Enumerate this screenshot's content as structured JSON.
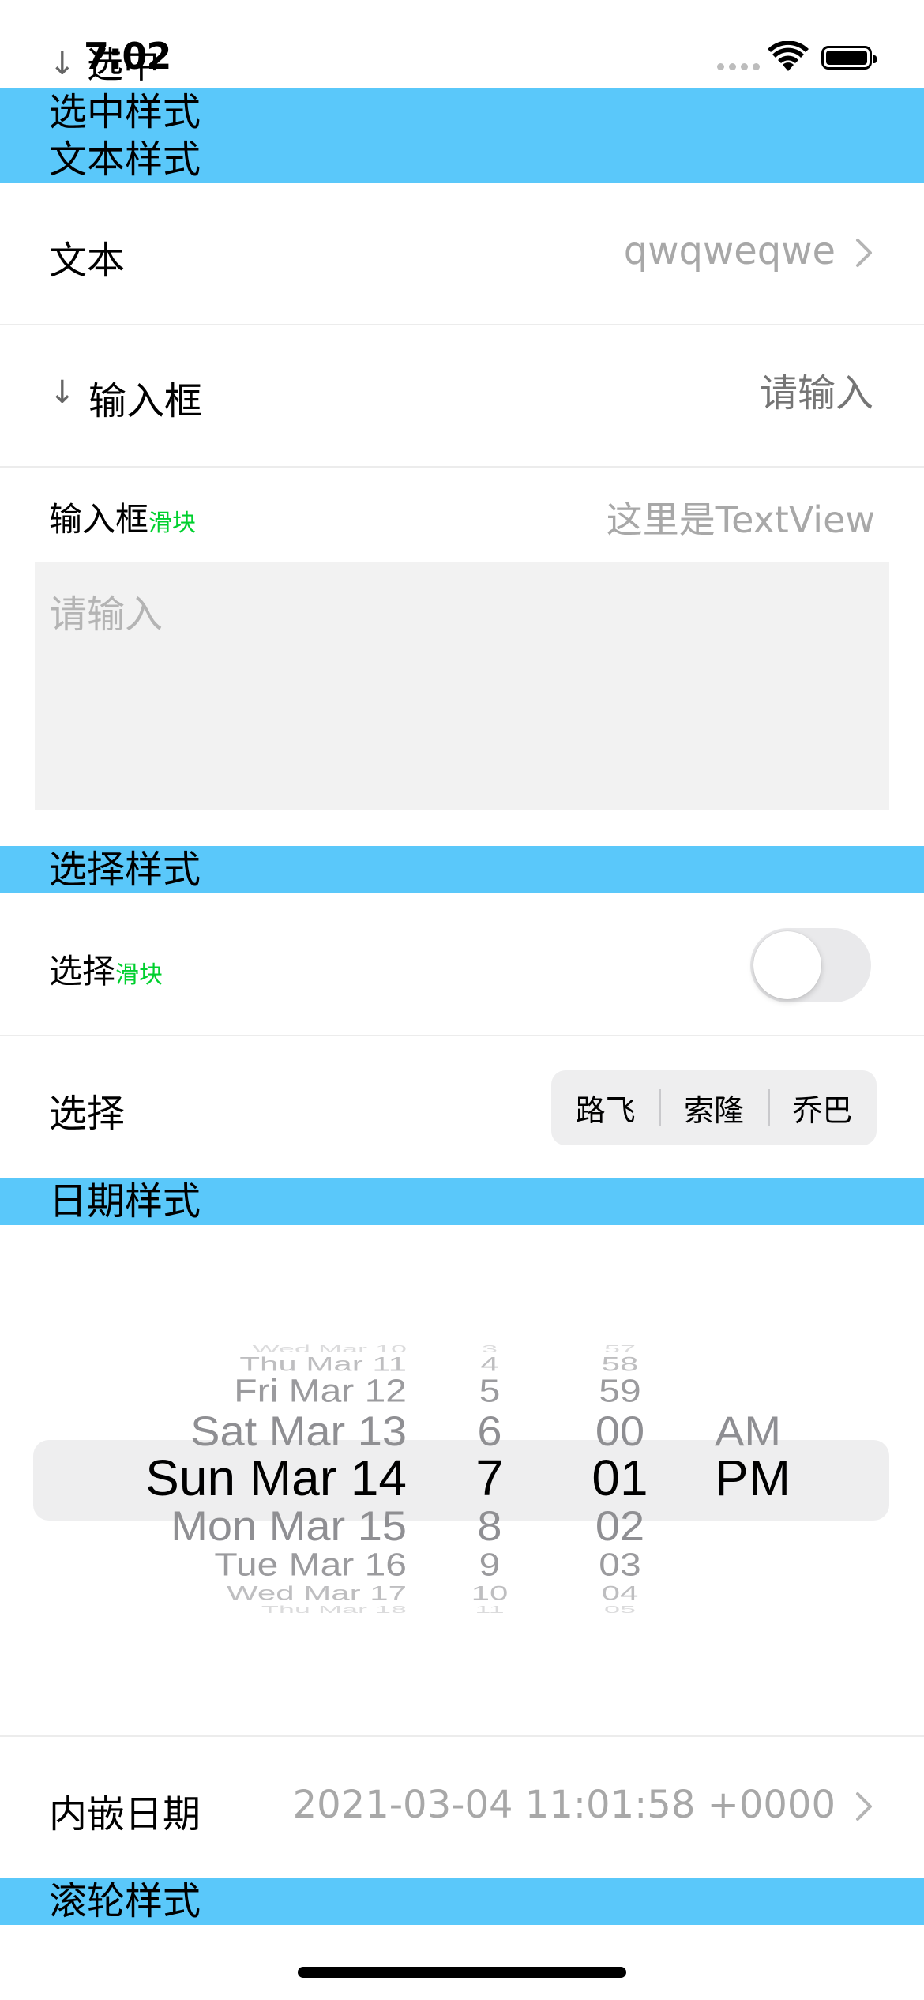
{
  "status_bar": {
    "time": "7:02",
    "overlap_text": "选中",
    "arrow": "↓"
  },
  "sections": {
    "selected_style": "选中样式",
    "text_style": "文本样式",
    "choice_style": "选择样式",
    "date_style": "日期样式",
    "wheel_style": "滚轮样式"
  },
  "text_row": {
    "label": "文本",
    "value": "qwqweqwe"
  },
  "input_row": {
    "arrow": "↓",
    "label": "输入框",
    "placeholder": "请输入"
  },
  "textview_row": {
    "label": "输入框",
    "slider_mark": "滑块",
    "value": "这里是TextView",
    "placeholder": "请输入"
  },
  "switch_row": {
    "label": "选择",
    "slider_mark": "滑块",
    "on": false
  },
  "segment_row": {
    "label": "选择",
    "segments": [
      "路飞",
      "索隆",
      "乔巴"
    ]
  },
  "date_picker": {
    "dates": [
      "Wed Mar 10",
      "Thu Mar 11",
      "Fri Mar 12",
      "Sat Mar 13",
      "Sun Mar 14",
      "Mon Mar 15",
      "Tue Mar 16",
      "Wed Mar 17",
      "Thu Mar 18"
    ],
    "hours": [
      "3",
      "4",
      "5",
      "6",
      "7",
      "8",
      "9",
      "10",
      "11"
    ],
    "minutes": [
      "57",
      "58",
      "59",
      "00",
      "01",
      "02",
      "03",
      "04",
      "05"
    ],
    "ampm": [
      "",
      "",
      "",
      "AM",
      "PM",
      "",
      "",
      "",
      ""
    ],
    "selected_index": 4
  },
  "inline_date_row": {
    "label": "内嵌日期",
    "value": "2021-03-04 11:01:58 +0000"
  },
  "colors": {
    "section_blue": "#5ac8fa",
    "slider_green": "#00d02e",
    "placeholder_gray": "#b4b4b4"
  }
}
